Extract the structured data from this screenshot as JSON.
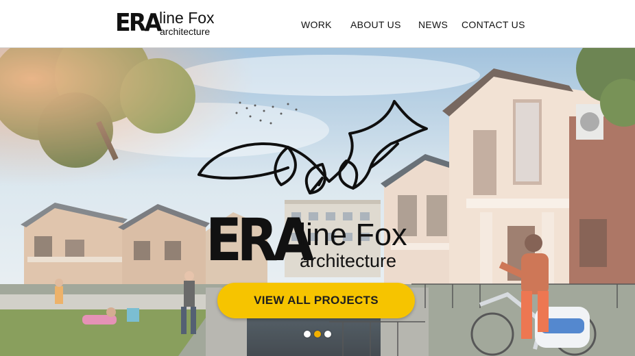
{
  "logo": {
    "mark": "ERA",
    "name": "line Fox",
    "tagline": "architecture"
  },
  "nav": [
    {
      "label": "WORK"
    },
    {
      "label": "ABOUT US"
    },
    {
      "label": "NEWS"
    },
    {
      "label": "CONTACT US"
    }
  ],
  "hero": {
    "logo_mark": "ERA",
    "logo_name": "line Fox",
    "logo_tagline": "architecture",
    "cta_label": "VIEW ALL PROJECTS",
    "slides": {
      "total": 3,
      "active": 2
    }
  },
  "colors": {
    "accent": "#f6c400",
    "active_dot": "#f2b000",
    "text": "#111111"
  }
}
